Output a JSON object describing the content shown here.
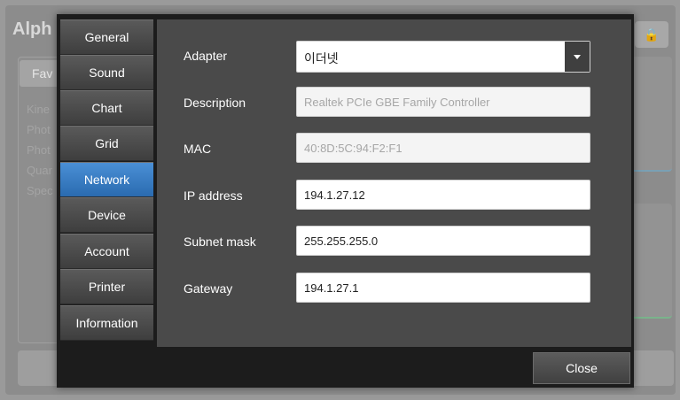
{
  "background": {
    "title": "Alph",
    "favorites_label": "Fav",
    "list_items": [
      "Kine",
      "Phot",
      "Phot",
      "Quar",
      "Spec"
    ]
  },
  "sidebar": {
    "tabs": [
      {
        "label": "General",
        "active": false
      },
      {
        "label": "Sound",
        "active": false
      },
      {
        "label": "Chart",
        "active": false
      },
      {
        "label": "Grid",
        "active": false
      },
      {
        "label": "Network",
        "active": true
      },
      {
        "label": "Device",
        "active": false
      },
      {
        "label": "Account",
        "active": false
      },
      {
        "label": "Printer",
        "active": false
      },
      {
        "label": "Information",
        "active": false
      }
    ]
  },
  "network": {
    "adapter": {
      "label": "Adapter",
      "value": "이더넷"
    },
    "description": {
      "label": "Description",
      "value": "Realtek PCIe GBE Family Controller"
    },
    "mac": {
      "label": "MAC",
      "value": "40:8D:5C:94:F2:F1"
    },
    "ip_address": {
      "label": "IP address",
      "value": "194.1.27.12"
    },
    "subnet_mask": {
      "label": "Subnet mask",
      "value": "255.255.255.0"
    },
    "gateway": {
      "label": "Gateway",
      "value": "194.1.27.1"
    }
  },
  "footer": {
    "close_label": "Close"
  },
  "colors": {
    "active_tab": "#3a7fc8",
    "dialog_bg": "#1c1c1c",
    "content_bg": "#4a4a4a"
  }
}
